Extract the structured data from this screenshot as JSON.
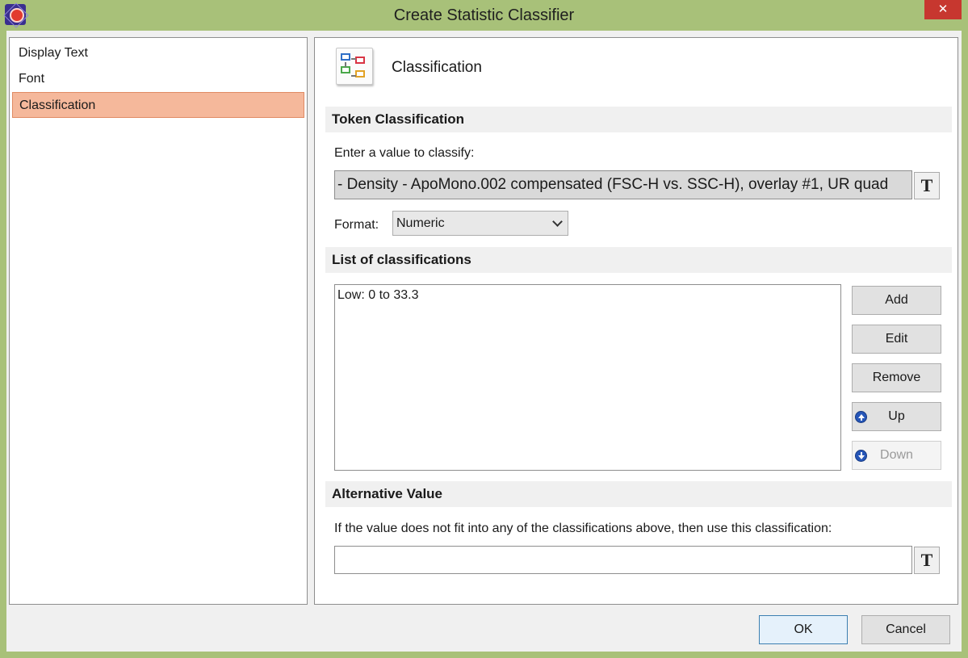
{
  "window": {
    "title": "Create Statistic Classifier",
    "close_label": "✕"
  },
  "sidebar": {
    "items": [
      {
        "label": "Display Text"
      },
      {
        "label": "Font"
      },
      {
        "label": "Classification",
        "selected": true
      }
    ]
  },
  "panel": {
    "title": "Classification",
    "icon": "classification-icon"
  },
  "token_classification": {
    "header": "Token Classification",
    "prompt": "Enter a value to classify:",
    "value": "- Density - ApoMono.002 compensated (FSC-H vs. SSC-H), overlay #1, UR quad",
    "token_button": "T",
    "format_label": "Format:",
    "format_value": "Numeric"
  },
  "classifications": {
    "header": "List of classifications",
    "items": [
      "Low: 0 to 33.3"
    ],
    "buttons": {
      "add": "Add",
      "edit": "Edit",
      "remove": "Remove",
      "up": "Up",
      "down": "Down"
    }
  },
  "alternative": {
    "header": "Alternative Value",
    "prompt": "If the value does not fit into any of the classifications above, then use this classification:",
    "value": "",
    "token_button": "T"
  },
  "footer": {
    "ok": "OK",
    "cancel": "Cancel"
  },
  "colors": {
    "frame": "#a8c179",
    "selected_item": "#f5b89b",
    "close_button": "#c7372f"
  }
}
